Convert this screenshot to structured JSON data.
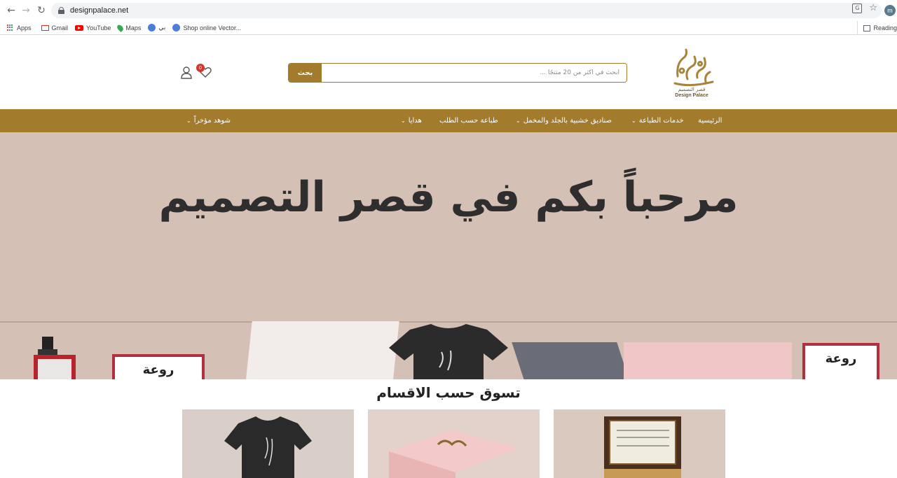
{
  "browser": {
    "url": "designpalace.net",
    "profile_initial": "m",
    "bookmarks": [
      "Apps",
      "Gmail",
      "YouTube",
      "Maps",
      "بي",
      "Shop online Vector..."
    ],
    "reading_list": "Reading"
  },
  "header": {
    "logo_arabic_name": "قصر التصميم",
    "logo_english_name": "Design Palace",
    "search_placeholder": "ابحث في أكثر من 20 منتجًا ...",
    "search_button": "بحث",
    "wishlist_count": "0"
  },
  "nav": {
    "items": [
      {
        "label": "الرئيسية",
        "dropdown": false
      },
      {
        "label": "خدمات الطباعة",
        "dropdown": true
      },
      {
        "label": "صناديق خشبية بالجلد والمخمل",
        "dropdown": true
      },
      {
        "label": "طباعة حسب الطلب",
        "dropdown": false
      },
      {
        "label": "هدايا",
        "dropdown": true
      },
      {
        "label": "شوهد مؤخراً",
        "dropdown": true
      }
    ]
  },
  "hero": {
    "title": "مرحباً بكم في قصر التصميم",
    "frame_text": "روعة"
  },
  "categories": {
    "title": "تسوق حسب الاقسام"
  },
  "colors": {
    "brand_gold": "#a37b2c",
    "hero_bg": "#d5c0b5",
    "badge_red": "#d9342b"
  }
}
